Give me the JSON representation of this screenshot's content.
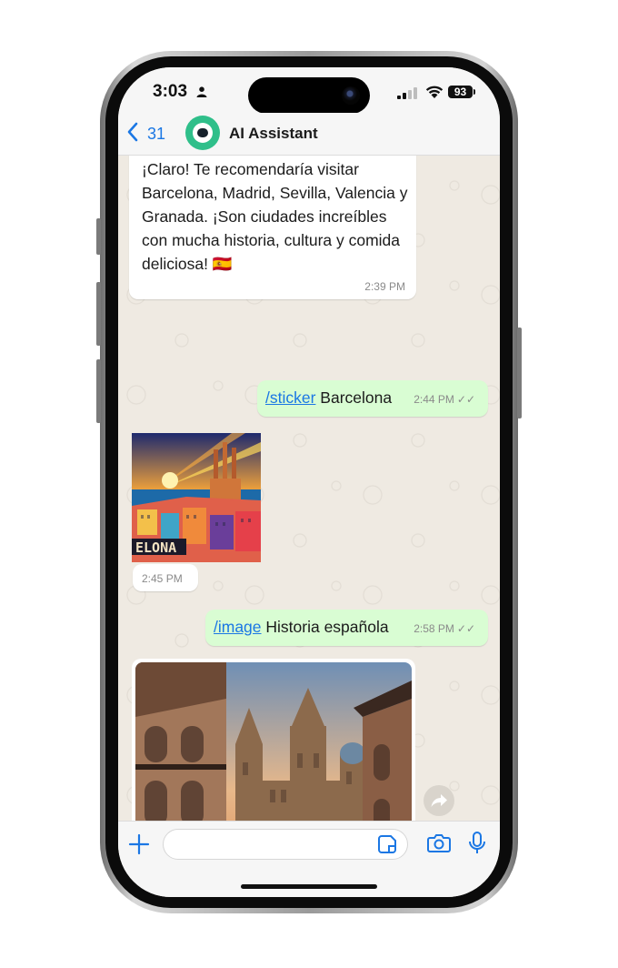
{
  "status_bar": {
    "time": "3:03",
    "battery": "93"
  },
  "header": {
    "back_count": "31",
    "contact_name": "AI Assistant"
  },
  "messages": [
    {
      "type": "incoming_text",
      "text": "¡Claro! Te recomendaría visitar Barcelona, Madrid, Sevilla, Valencia y Granada. ¡Son ciudades increíbles con mucha historia, cultura y comida deliciosa! 🇪🇸",
      "time": "2:39 PM"
    },
    {
      "type": "outgoing_command",
      "command": "/sticker",
      "text": " Barcelona",
      "time": "2:44 PM",
      "status": "✓✓"
    },
    {
      "type": "incoming_sticker",
      "caption": "ELONA",
      "time": "2:45 PM"
    },
    {
      "type": "outgoing_command",
      "command": "/image",
      "text": " Historia española",
      "time": "2:58 PM",
      "status": "✓✓"
    },
    {
      "type": "incoming_image"
    }
  ],
  "colors": {
    "accent": "#1b77e4",
    "outgoing_bubble": "#d9fdd3",
    "chat_bg": "#efeae2",
    "avatar": "#2fbf8a"
  },
  "icons": [
    "person-icon",
    "signal-icon",
    "wifi-icon",
    "back-chevron-icon",
    "sticker-icon",
    "camera-icon",
    "mic-icon",
    "plus-icon",
    "forward-icon"
  ]
}
